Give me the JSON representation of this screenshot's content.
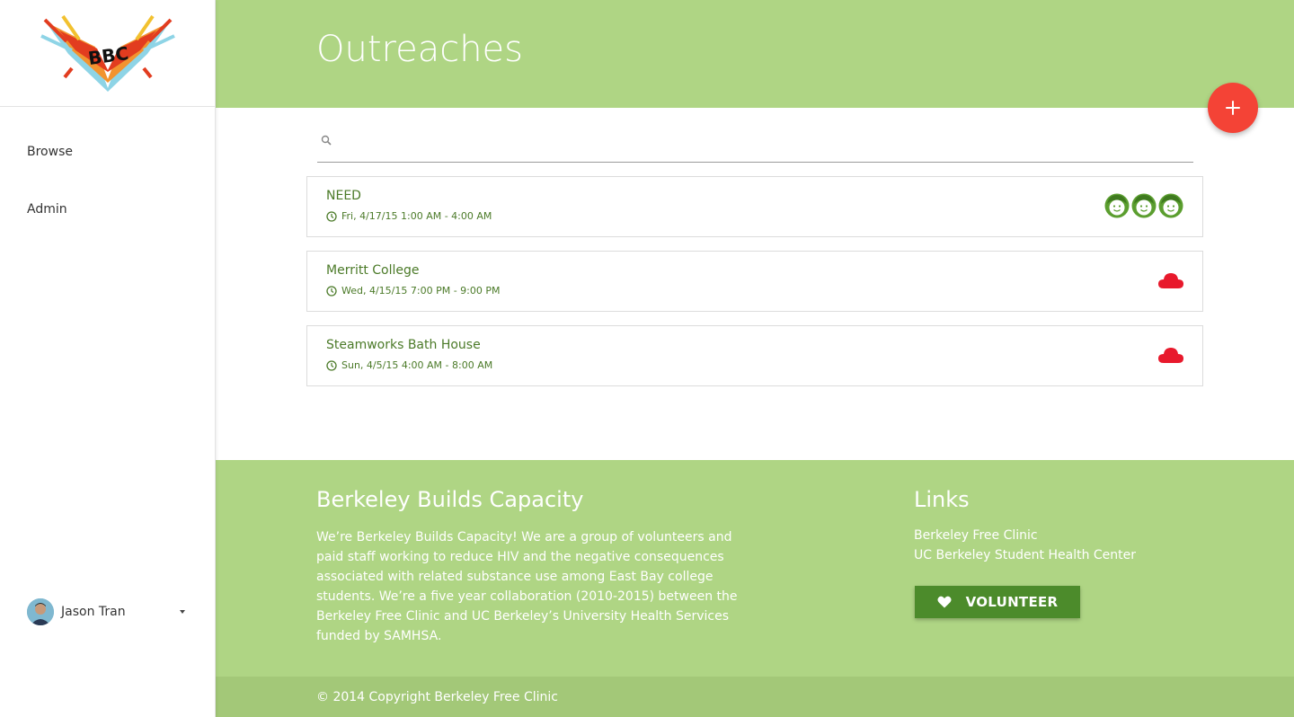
{
  "sidebar": {
    "logo_text": "BBC",
    "nav": [
      {
        "label": "Browse"
      },
      {
        "label": "Admin"
      }
    ],
    "user": {
      "name": "Jason Tran"
    }
  },
  "header": {
    "title": "Outreaches"
  },
  "search": {
    "placeholder": ""
  },
  "outreaches": [
    {
      "name": "NEED",
      "time": "Fri, 4/17/15 1:00 AM - 4:00 AM",
      "status_icon": "faces-icon"
    },
    {
      "name": "Merritt College",
      "time": "Wed, 4/15/15 7:00 PM - 9:00 PM",
      "status_icon": "cloud-icon"
    },
    {
      "name": "Steamworks Bath House",
      "time": "Sun, 4/5/15 4:00 AM - 8:00 AM",
      "status_icon": "cloud-icon"
    }
  ],
  "footer": {
    "title": "Berkeley Builds Capacity",
    "text": "We’re Berkeley Builds Capacity! We are a group of volunteers and paid staff working to reduce HIV and the negative consequences associated with related substance use among East Bay college students. We’re a five year collaboration (2010-2015) between the Berkeley Free Clinic and UC Berkeley’s University Health Services funded by SAMHSA.",
    "links_title": "Links",
    "links": [
      {
        "label": "Berkeley Free Clinic"
      },
      {
        "label": "UC Berkeley Student Health Center"
      }
    ],
    "volunteer_label": "VOLUNTEER",
    "copyright": "© 2014 Copyright Berkeley Free Clinic"
  },
  "colors": {
    "primary": "#afd584",
    "accent": "#f44336",
    "card_text": "#4b7a28",
    "button": "#4c8b2b",
    "status_red": "#e8192c"
  }
}
